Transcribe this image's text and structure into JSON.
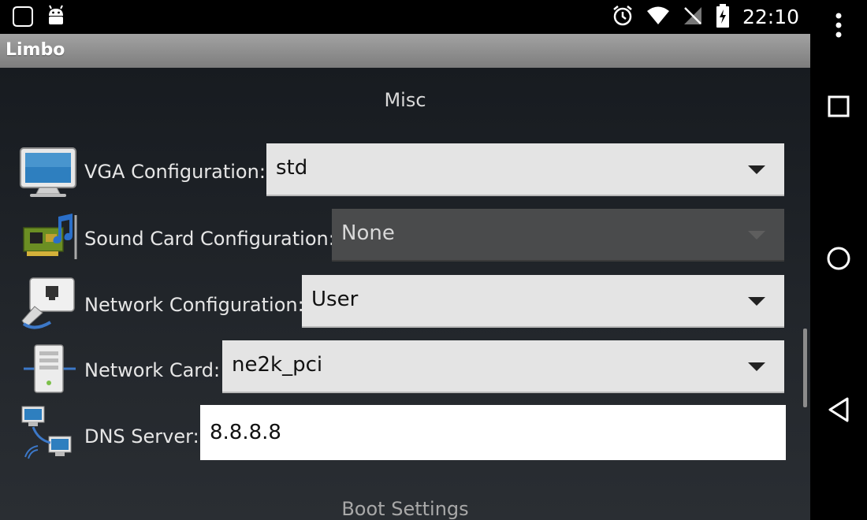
{
  "status_bar": {
    "left_icons": [
      "notification-bubble-icon",
      "android-debug-icon"
    ],
    "right_icons": [
      "alarm-icon",
      "wifi-icon",
      "no-signal-icon",
      "battery-charging-icon"
    ],
    "clock": "22:10"
  },
  "app": {
    "title": "Limbo"
  },
  "misc_section": {
    "title": "Misc",
    "vga": {
      "label": "VGA Configuration:",
      "value": "std",
      "icon": "monitor-icon"
    },
    "sound": {
      "label": "Sound Card Configuration:",
      "value": "None",
      "icon": "sound-card-icon",
      "enabled": false
    },
    "network": {
      "label": "Network Configuration:",
      "value": "User",
      "icon": "network-port-icon"
    },
    "network_card": {
      "label": "Network Card:",
      "value": "ne2k_pci",
      "icon": "server-tower-icon"
    },
    "dns": {
      "label": "DNS Server:",
      "value": "8.8.8.8",
      "icon": "networked-computers-icon"
    }
  },
  "boot_section": {
    "title": "Boot Settings"
  },
  "navigation": {
    "buttons": [
      "overflow-menu-icon",
      "recents-icon",
      "home-icon",
      "back-icon"
    ]
  },
  "colors": {
    "background": "#1c2025",
    "title_bar": "#8f8f8f",
    "dropdown": "#e4e4e4",
    "dropdown_disabled": "#4a4b4c",
    "text_light": "#e6e6e6"
  }
}
